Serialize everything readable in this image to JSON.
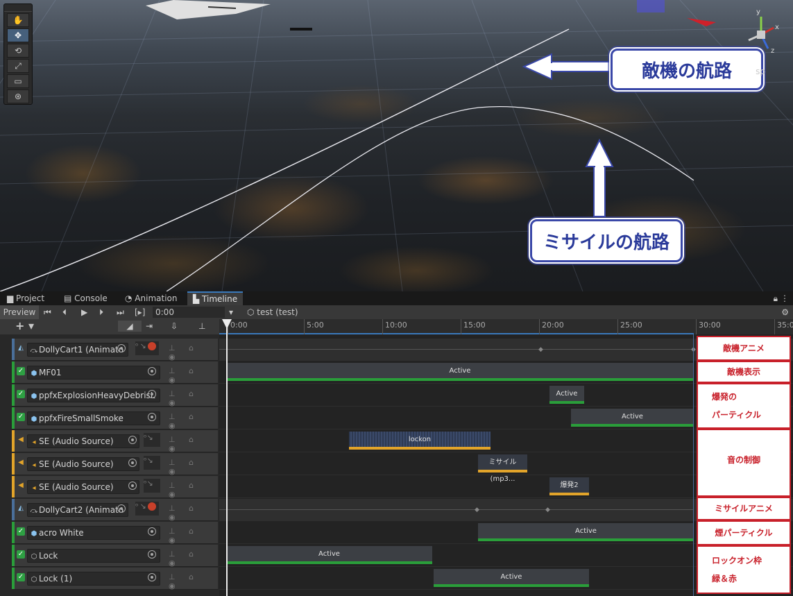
{
  "scene": {
    "callout_enemy": "敵機の航路",
    "callout_missile": "ミサイルの航路",
    "persp_label": "sp",
    "gizmo_axes": [
      "y",
      "x",
      "z"
    ],
    "tools": [
      "hand-icon",
      "move-icon",
      "rotate-icon",
      "scale-icon",
      "rect-icon",
      "transform-icon"
    ]
  },
  "tabs": [
    {
      "label": "Project",
      "icon": "folder-icon"
    },
    {
      "label": "Console",
      "icon": "console-icon"
    },
    {
      "label": "Animation",
      "icon": "clock-icon"
    },
    {
      "label": "Timeline",
      "icon": "timeline-icon",
      "active": true
    }
  ],
  "toolbar": {
    "preview": "Preview",
    "time": "0:00",
    "asset": "test (test)",
    "lock_icon": "lock-icon",
    "add_label": "+"
  },
  "ruler": [
    "0:00",
    "5:00",
    "10:00",
    "15:00",
    "20:00",
    "25:00",
    "30:00",
    "35:0"
  ],
  "tracks": [
    {
      "name": "DollyCart1 (Animato",
      "type": "animation",
      "color": "#4a6f9a"
    },
    {
      "name": "MF01",
      "type": "activation",
      "color": "#2a9e3a"
    },
    {
      "name": "ppfxExplosionHeavyDebrisL",
      "type": "activation",
      "color": "#2a9e3a"
    },
    {
      "name": "ppfxFireSmallSmoke",
      "type": "activation",
      "color": "#2a9e3a"
    },
    {
      "name": "SE (Audio Source)",
      "type": "audio",
      "color": "#e2a42a"
    },
    {
      "name": "SE (Audio Source)",
      "type": "audio",
      "color": "#e2a42a"
    },
    {
      "name": "SE (Audio Source)",
      "type": "audio",
      "color": "#e2a42a"
    },
    {
      "name": "DollyCart2 (Animato",
      "type": "animation",
      "color": "#4a6f9a"
    },
    {
      "name": "acro White",
      "type": "activation",
      "color": "#2a9e3a"
    },
    {
      "name": "Lock",
      "type": "activation",
      "color": "#2a9e3a"
    },
    {
      "name": "Lock (1)",
      "type": "activation",
      "color": "#2a9e3a"
    }
  ],
  "clips": {
    "mf01": "Active",
    "explosion": "Active",
    "smoke": "Active",
    "audio1": "lockon",
    "audio2": "ミサイル (mp3...",
    "audio3": "爆発2",
    "acro": "Active",
    "lock": "Active",
    "lock1": "Active"
  },
  "labels": {
    "enemy_anim": "敵機アニメ",
    "enemy_show": "敵機表示",
    "explosion_particle_1": "爆発の",
    "explosion_particle_2": "パーティクル",
    "sound": "音の制御",
    "missile_anim": "ミサイルアニメ",
    "smoke_particle": "煙パーティクル",
    "lockon_1": "ロックオン枠",
    "lockon_2": "緑＆赤"
  }
}
